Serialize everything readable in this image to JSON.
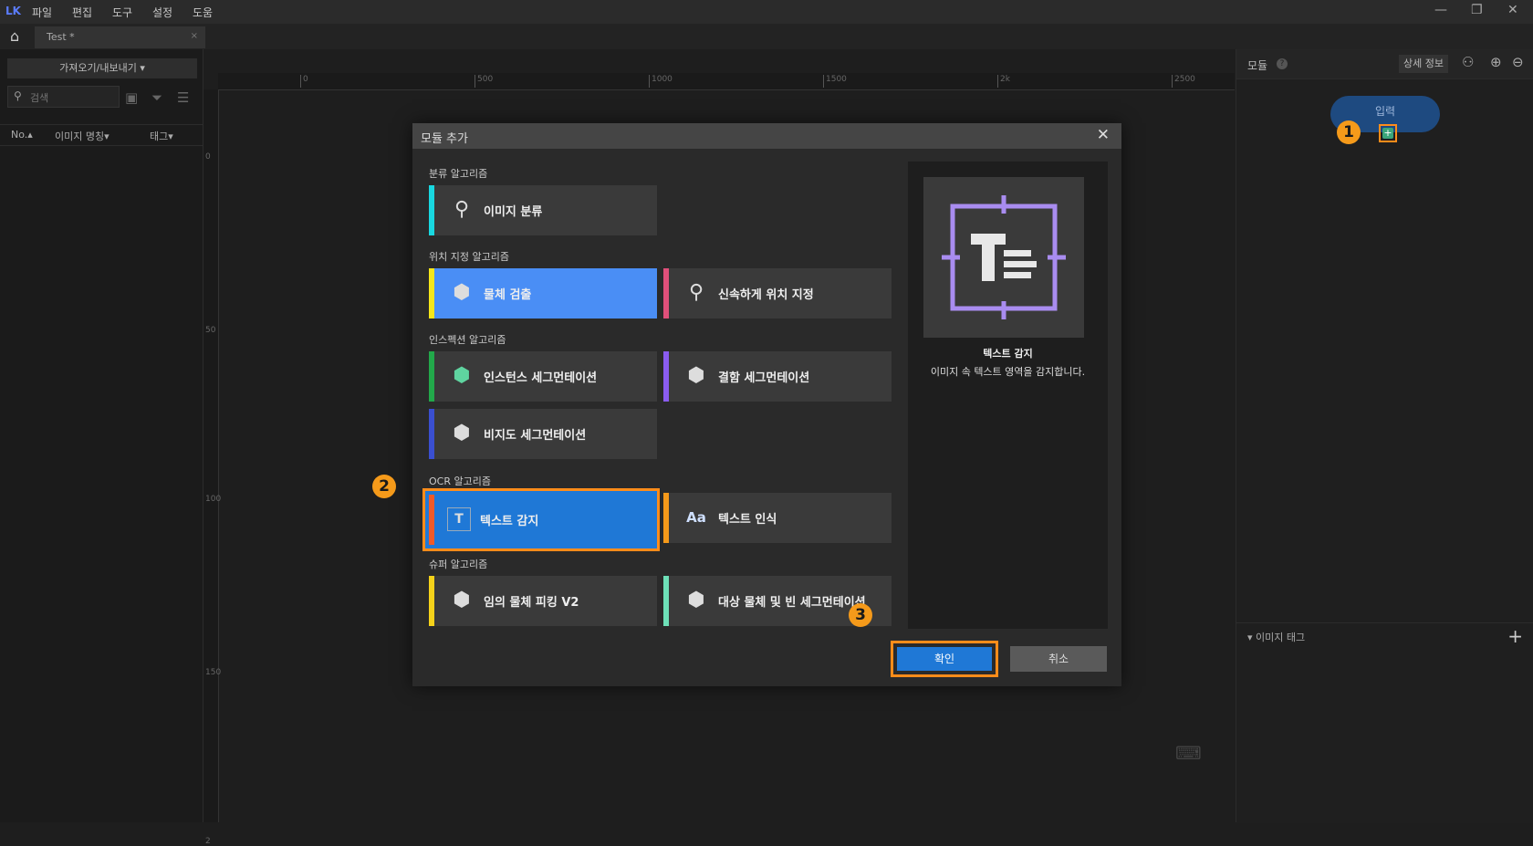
{
  "menu": {
    "logo": "LK",
    "items": [
      "파일",
      "편집",
      "도구",
      "설정",
      "도움"
    ]
  },
  "window": {
    "minimize": "—",
    "restore": "❐",
    "close": "✕"
  },
  "tab": {
    "title": "Test *",
    "close": "×"
  },
  "left_panel": {
    "import_export": "가져오기/내보내기 ▾",
    "search_placeholder": "검색",
    "columns": [
      "No.▴",
      "이미지 명칭▾",
      "태그▾"
    ]
  },
  "ruler": {
    "top": [
      "0",
      "500",
      "1000",
      "1500",
      "2k",
      "2500"
    ],
    "left": [
      "0",
      "50",
      "100",
      "150",
      "2"
    ]
  },
  "right_panel": {
    "title": "모듈",
    "help": "?",
    "detail_button": "상세 정보",
    "input_node": "입력",
    "image_tags": "▾ 이미지 태그",
    "add_tag": "+"
  },
  "steps": [
    "1",
    "2",
    "3"
  ],
  "dialog": {
    "title": "모듈 추가",
    "close": "✕",
    "categories": [
      {
        "label": "분류 알고리즘",
        "modules": [
          {
            "label": "이미지 분류",
            "color": "#19d8e0"
          }
        ]
      },
      {
        "label": "위치 지정 알고리즘",
        "modules": [
          {
            "label": "물체 검출",
            "color": "#f5e61a"
          },
          {
            "label": "신속하게 위치 지정",
            "color": "#e0507a"
          }
        ]
      },
      {
        "label": "인스펙션 알고리즘",
        "modules": [
          {
            "label": "인스턴스 세그먼테이션",
            "color": "#22a84a"
          },
          {
            "label": "결함 세그먼테이션",
            "color": "#8a5cf0"
          },
          {
            "label": "비지도 세그먼테이션",
            "color": "#3a4fd0"
          }
        ]
      },
      {
        "label": "OCR 알고리즘",
        "modules": [
          {
            "label": "텍스트 감지",
            "color": "#f05a28"
          },
          {
            "label": "텍스트 인식",
            "color": "#f59a1a"
          }
        ]
      },
      {
        "label": "슈퍼 알고리즘",
        "modules": [
          {
            "label": "임의 물체 피킹 V2",
            "color": "#f5d21a"
          },
          {
            "label": "대상 물체 및 빈 세그먼테이션",
            "color": "#6ee0b8"
          }
        ]
      }
    ],
    "preview": {
      "name": "텍스트 감지",
      "description": "이미지 속 텍스트 영역을 감지합니다."
    },
    "ok": "확인",
    "cancel": "취소"
  }
}
